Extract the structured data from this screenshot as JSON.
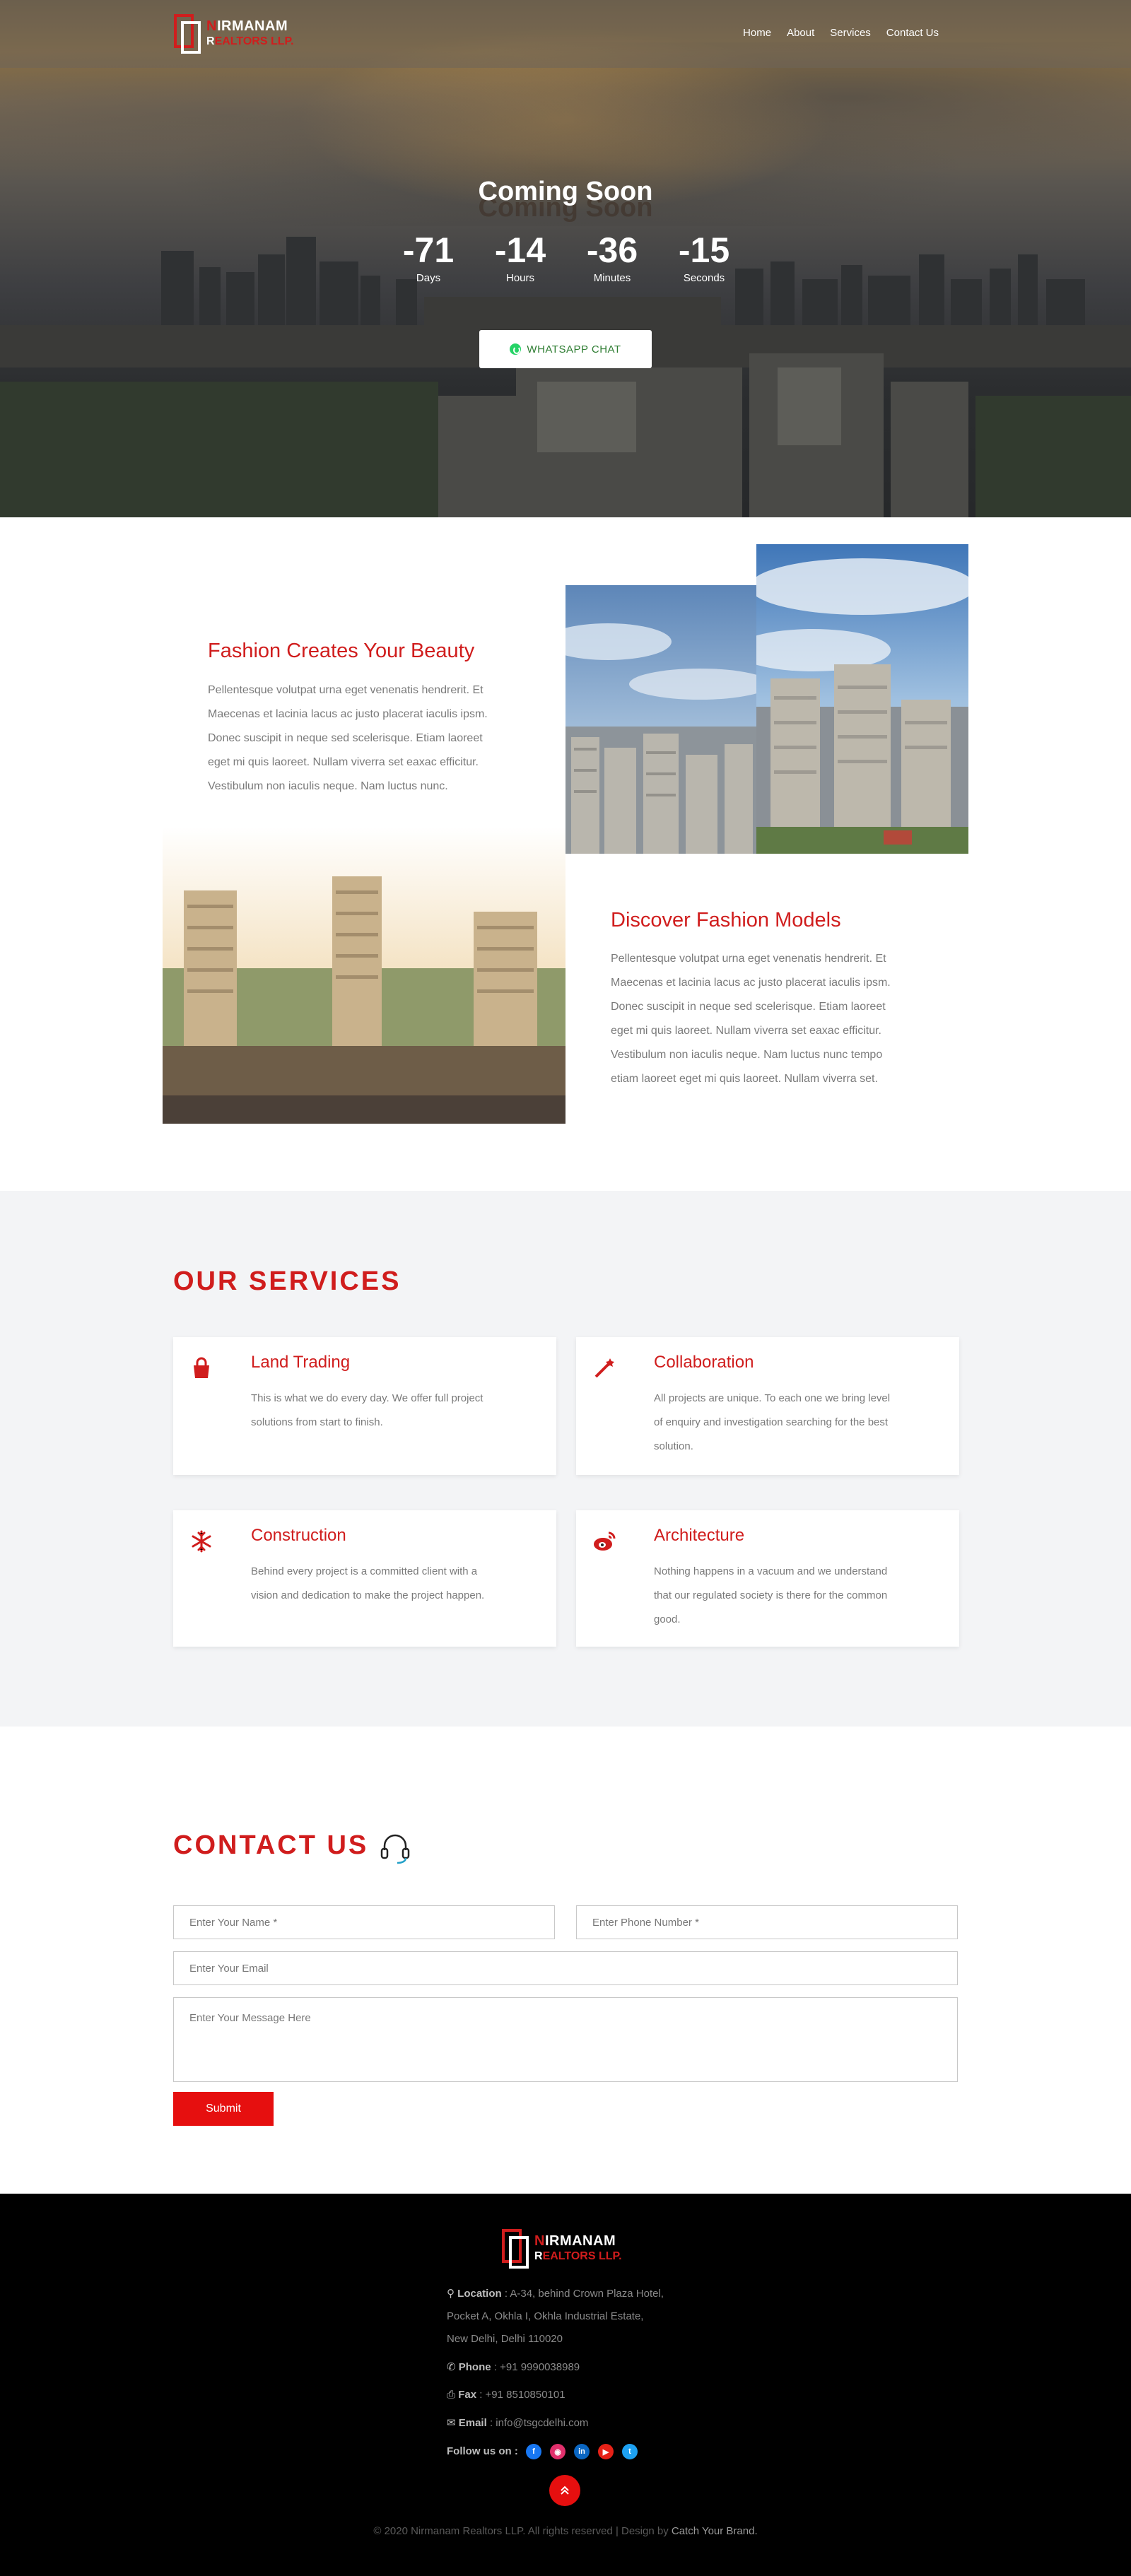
{
  "brand": {
    "line1_first": "N",
    "line1_rest": "IRMANAM",
    "line2_first": "R",
    "line2_rest": "EALTORS LLP."
  },
  "nav": {
    "items": [
      "Home",
      "About",
      "Services",
      "Contact Us"
    ]
  },
  "hero": {
    "title": "Coming Soon",
    "countdown": [
      {
        "value": "-71",
        "label": "Days"
      },
      {
        "value": "-14",
        "label": "Hours"
      },
      {
        "value": "-36",
        "label": "Minutes"
      },
      {
        "value": "-15",
        "label": "Seconds"
      }
    ],
    "whatsapp_label": "WHATSAPP CHAT"
  },
  "features": [
    {
      "title": "Fashion Creates Your Beauty",
      "lines": [
        "Pellentesque volutpat urna eget venenatis hendrerit. Et",
        "Maecenas et lacinia lacus ac justo placerat iaculis ipsm.",
        "Donec suscipit in neque sed scelerisque. Etiam laoreet",
        "eget mi quis laoreet. Nullam viverra set eaxac efficitur.",
        "Vestibulum non iaculis neque. Nam luctus nunc."
      ]
    },
    {
      "title": "Discover Fashion Models",
      "lines": [
        "Pellentesque volutpat urna eget venenatis hendrerit. Et",
        "Maecenas et lacinia lacus ac justo placerat iaculis ipsm.",
        "Donec suscipit in neque sed scelerisque. Etiam laoreet",
        "eget mi quis laoreet. Nullam viverra set eaxac efficitur.",
        "Vestibulum non iaculis neque. Nam luctus nunc tempo",
        "etiam laoreet eget mi quis laoreet. Nullam viverra set."
      ]
    }
  ],
  "services": {
    "title": "OUR SERVICES",
    "cards": [
      {
        "icon": "shopping-bag-icon",
        "title": "Land Trading",
        "lines": [
          "This is what we do every day. We offer full project",
          "solutions from start to finish."
        ]
      },
      {
        "icon": "magic-wand-icon",
        "title": "Collaboration",
        "lines": [
          "All projects are unique. To each one we bring level",
          "of enquiry and investigation searching for the best",
          "solution."
        ]
      },
      {
        "icon": "snowflake-icon",
        "title": "Construction",
        "lines": [
          "Behind every project is a committed client with a",
          "vision and dedication to make the project happen."
        ]
      },
      {
        "icon": "weibo-icon",
        "title": "Architecture",
        "lines": [
          "Nothing happens in a vacuum and we understand",
          "that our regulated society is there for the common",
          "good."
        ]
      }
    ]
  },
  "contact": {
    "title": "CONTACT US",
    "name_placeholder": "Enter Your Name *",
    "phone_placeholder": "Enter Phone Number *",
    "email_placeholder": "Enter Your Email",
    "message_placeholder": "Enter Your Message Here",
    "submit_label": "Submit"
  },
  "footer": {
    "location_label": "Location",
    "location_lines": [
      " : A-34, behind Crown Plaza Hotel,",
      "Pocket A, Okhla I, Okhla Industrial Estate,",
      "New Delhi, Delhi 110020"
    ],
    "phone_label": "Phone",
    "phone_value": " : +91 9990038989",
    "fax_label": "Fax",
    "fax_value": " : +91 8510850101",
    "email_label": "Email",
    "email_value": " : info@tsgcdelhi.com",
    "follow_label": "Follow us on :",
    "socials": [
      {
        "icon": "facebook-icon",
        "glyph": "f",
        "color": "#1877f2"
      },
      {
        "icon": "instagram-icon",
        "glyph": "◉",
        "color": "#e1306c"
      },
      {
        "icon": "linkedin-icon",
        "glyph": "in",
        "color": "#0a66c2"
      },
      {
        "icon": "youtube-icon",
        "glyph": "▶",
        "color": "#e62117"
      },
      {
        "icon": "twitter-icon",
        "glyph": "t",
        "color": "#1da1f2"
      }
    ],
    "copyright_pre": "© 2020 Nirmanam Realtors LLP. All rights reserved | Design by ",
    "copyright_brand": "Catch Your Brand."
  },
  "colors": {
    "accent": "#d01d1d",
    "button": "#e60f0f",
    "services_bg": "#f3f4f6",
    "footer_bg": "#000000"
  }
}
